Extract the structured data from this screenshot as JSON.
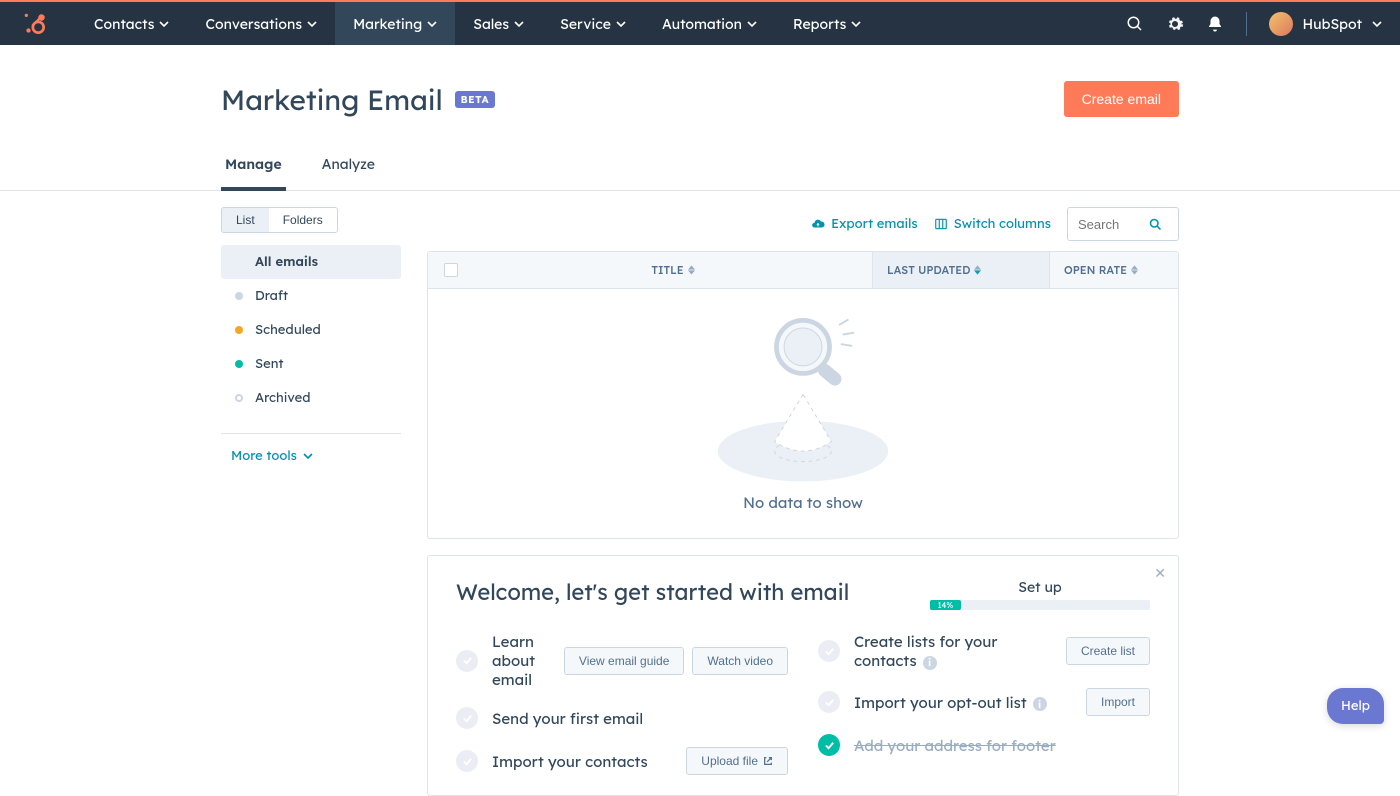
{
  "nav": {
    "items": [
      "Contacts",
      "Conversations",
      "Marketing",
      "Sales",
      "Service",
      "Automation",
      "Reports"
    ],
    "active_index": 2,
    "account_label": "HubSpot"
  },
  "page": {
    "title": "Marketing Email",
    "beta_badge": "BETA",
    "create_button": "Create email"
  },
  "tabs": {
    "manage": "Manage",
    "analyze": "Analyze",
    "active": 0
  },
  "view_toggle": {
    "list": "List",
    "folders": "Folders",
    "active": 0
  },
  "sidebar": {
    "items": [
      {
        "label": "All emails",
        "dot": null
      },
      {
        "label": "Draft",
        "dot": "grey"
      },
      {
        "label": "Scheduled",
        "dot": "orange"
      },
      {
        "label": "Sent",
        "dot": "teal"
      },
      {
        "label": "Archived",
        "dot": "ring"
      }
    ],
    "more_tools": "More tools"
  },
  "toolbar": {
    "export": "Export emails",
    "switch_cols": "Switch columns",
    "search_placeholder": "Search"
  },
  "table": {
    "columns": {
      "title": "TITLE",
      "updated": "LAST UPDATED",
      "open": "OPEN RATE"
    },
    "empty_text": "No data to show"
  },
  "welcome": {
    "title": "Welcome, let's get started with email",
    "setup_label": "Set up",
    "progress_pct": 14,
    "progress_text": "14%",
    "left": [
      {
        "label": "Learn about email",
        "done": false,
        "buttons": [
          "View email guide",
          "Watch video"
        ]
      },
      {
        "label": "Send your first email",
        "done": false,
        "buttons": []
      },
      {
        "label": "Import your contacts",
        "done": false,
        "buttons": [
          "Upload file"
        ],
        "button_icon": "external"
      }
    ],
    "right": [
      {
        "label": "Create lists for your contacts",
        "done": false,
        "info": true,
        "buttons": [
          "Create list"
        ]
      },
      {
        "label": "Import your opt-out list",
        "done": false,
        "info": true,
        "buttons": [
          "Import"
        ]
      },
      {
        "label": "Add your address for footer",
        "done": true,
        "buttons": []
      }
    ]
  },
  "help_label": "Help"
}
